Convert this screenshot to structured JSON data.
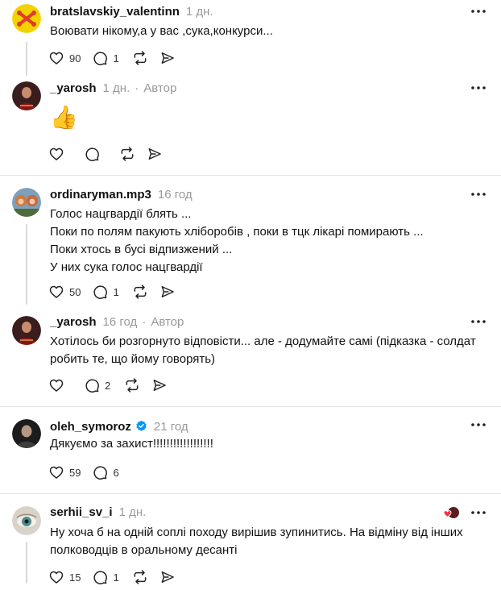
{
  "posts": [
    {
      "username": "bratslavskiy_valentinn",
      "time": "1 дн.",
      "lines": [
        "Воювати нікому,а у вас ,сука,конкурси..."
      ],
      "likes": "90",
      "replies": "1"
    },
    {
      "username": "_yarosh",
      "time": "1 дн.",
      "author_badge": "Автор",
      "emoji": "👍",
      "likes": "",
      "replies": ""
    },
    {
      "username": "ordinaryman.mp3",
      "time": "16 год",
      "lines": [
        "Голос нацгвардії блять ...",
        "Поки по полям пакують хліборобів , поки в тцк лікарі помирають ...",
        "Поки хтось в бусі відпизжений ...",
        "У них сука голос нацгвардії"
      ],
      "likes": "50",
      "replies": "1"
    },
    {
      "username": "_yarosh",
      "time": "16 год",
      "author_badge": "Автор",
      "lines": [
        "Хотілось би розгорнуто відповісти... але - додумайте самі (підказка - солдат",
        "робить те, що йому говорять)"
      ],
      "likes": "",
      "replies": "2"
    },
    {
      "username": "oleh_symoroz",
      "verified": true,
      "time": "21 год",
      "lines": [
        "Дякуємо за захист!!!!!!!!!!!!!!!!!!"
      ],
      "likes": "59",
      "replies": "6"
    },
    {
      "username": "serhii_sv_i",
      "time": "1 дн.",
      "lines": [
        "Ну хоча б на одній соплі походу вирішив зупинитись. На відміну від інших",
        "полководців в оральному десанті"
      ],
      "likes": "15",
      "replies": "1"
    }
  ],
  "sep_char": "·",
  "colors": {
    "text": "#111111",
    "muted": "#999999",
    "divider": "#e5e5e5",
    "thread_line": "#d9d9d9",
    "verified": "#0095f6",
    "heart_red": "#ff3040"
  },
  "icons": [
    "heart-icon",
    "comment-icon",
    "repost-icon",
    "share-icon",
    "more-icon",
    "verified-badge-icon"
  ]
}
